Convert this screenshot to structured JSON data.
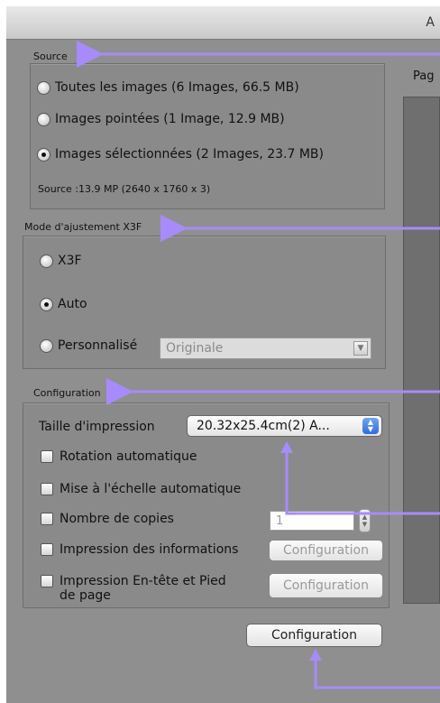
{
  "window": {
    "title_fragment": "A"
  },
  "source": {
    "label": "Source",
    "options": [
      {
        "label": "Toutes les images  (6 Images, 66.5 MB)",
        "selected": false
      },
      {
        "label": "Images pointées  (1 Image, 12.9 MB)",
        "selected": false
      },
      {
        "label": "Images sélectionnées  (2 Images, 23.7 MB)",
        "selected": true
      }
    ],
    "info": "Source :13.9 MP (2640 x 1760 x 3)"
  },
  "mode": {
    "label": "Mode d'ajustement X3F",
    "options": [
      {
        "label": "X3F",
        "selected": false
      },
      {
        "label": "Auto",
        "selected": true
      },
      {
        "label": "Personnalisé",
        "selected": false
      }
    ],
    "custom_select_value": "Originale"
  },
  "config": {
    "label": "Configuration",
    "print_size_label": "Taille d'impression",
    "print_size_value": "20.32x25.4cm(2) A...",
    "auto_rotate_label": "Rotation automatique",
    "auto_scale_label": "Mise à l'échelle automatique",
    "copies_label": "Nombre de copies",
    "copies_value": "1",
    "print_info_label": "Impression des informations",
    "print_info_button": "Configuration",
    "header_footer_label_1": "Impression En-tête et Pied",
    "header_footer_label_2": "de page",
    "header_footer_button": "Configuration"
  },
  "bottom_button": "Configuration",
  "preview": {
    "label": "Pag"
  },
  "colors": {
    "annotation": "#a78bfa",
    "panel": "#8a8a8a",
    "background": "#8f8f8f"
  }
}
